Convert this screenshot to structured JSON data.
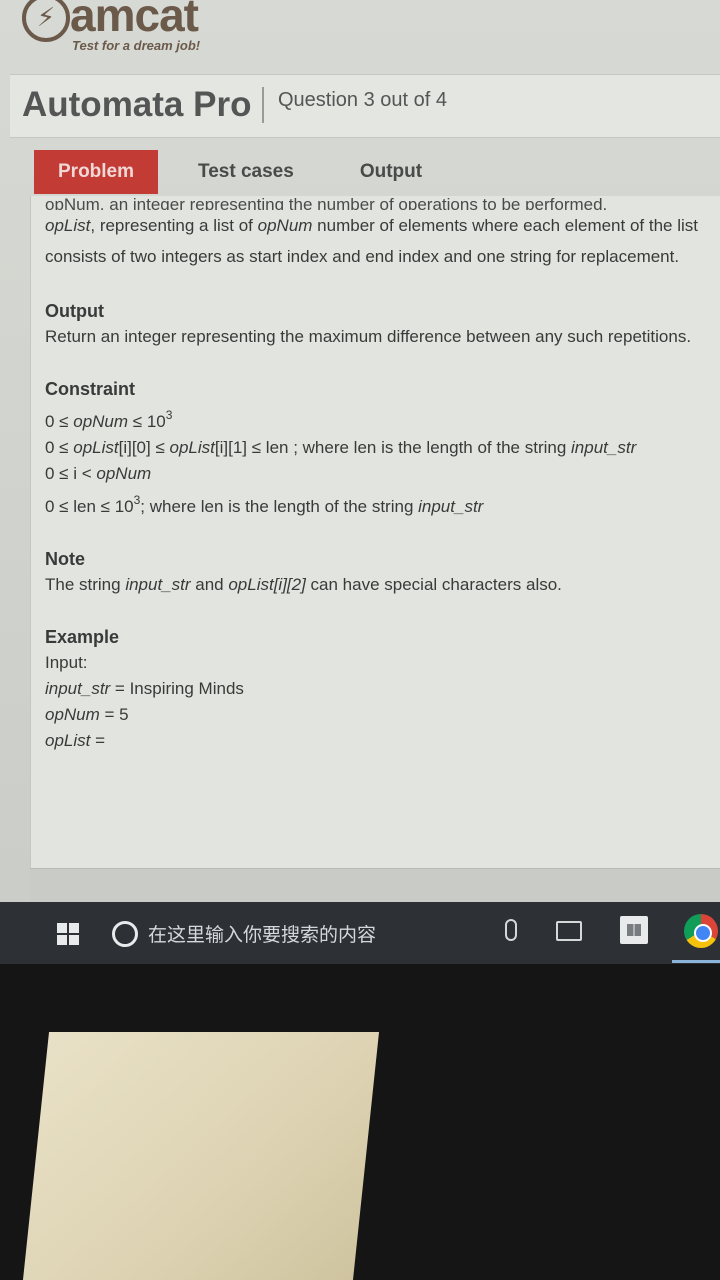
{
  "brand": {
    "logo_glyph": "⚡",
    "name": "amcat",
    "tagline": "Test for a dream job!"
  },
  "header": {
    "product": "Automata Pro",
    "question_counter": "Question 3 out of 4"
  },
  "tabs": [
    {
      "label": "Problem",
      "active": true
    },
    {
      "label": "Test cases",
      "active": false
    },
    {
      "label": "Output",
      "active": false
    }
  ],
  "content": {
    "cut_line": "opNum, an integer representing the number of operations to be performed.",
    "input_para": {
      "part1": "opList",
      "part2": ", representing a list of ",
      "part3": "opNum",
      "part4": " number of elements where each element of the list consists of two integers as start index and end index and one string for replacement."
    },
    "output": {
      "title": "Output",
      "text": "Return an integer representing the maximum difference between any such repetitions."
    },
    "constraint": {
      "title": "Constraint",
      "c1_a": "0 ≤ ",
      "c1_b": "opNum",
      "c1_c": " ≤ 10",
      "c1_sup": "3",
      "c2_a": "0 ≤ ",
      "c2_b": "opList",
      "c2_c": "[i][0] ≤ ",
      "c2_d": "opList",
      "c2_e": "[i][1] ≤ len ; where len is the length of the string ",
      "c2_f": "input_str",
      "c3_a": "0 ≤ i < ",
      "c3_b": "opNum",
      "c4_a": "0 ≤ len ≤ 10",
      "c4_sup": "3",
      "c4_b": "; where len is the length of the string ",
      "c4_c": "input_str"
    },
    "note": {
      "title": "Note",
      "a": "The string ",
      "b": "input_str",
      "c": " and ",
      "d": "opList[i][2]",
      "e": " can have special characters also."
    },
    "example": {
      "title": "Example",
      "input_label": "Input:",
      "l1_a": "input_str",
      "l1_b": " = Inspiring Minds",
      "l2_a": "opNum",
      "l2_b": " = 5",
      "l3_a": "opList",
      "l3_b": " ="
    }
  },
  "taskbar": {
    "search_placeholder": "在这里输入你要搜索的内容",
    "icons": [
      "windows-start-icon",
      "cortana-icon",
      "microphone-icon",
      "task-view-icon",
      "store-icon",
      "chrome-icon"
    ]
  }
}
